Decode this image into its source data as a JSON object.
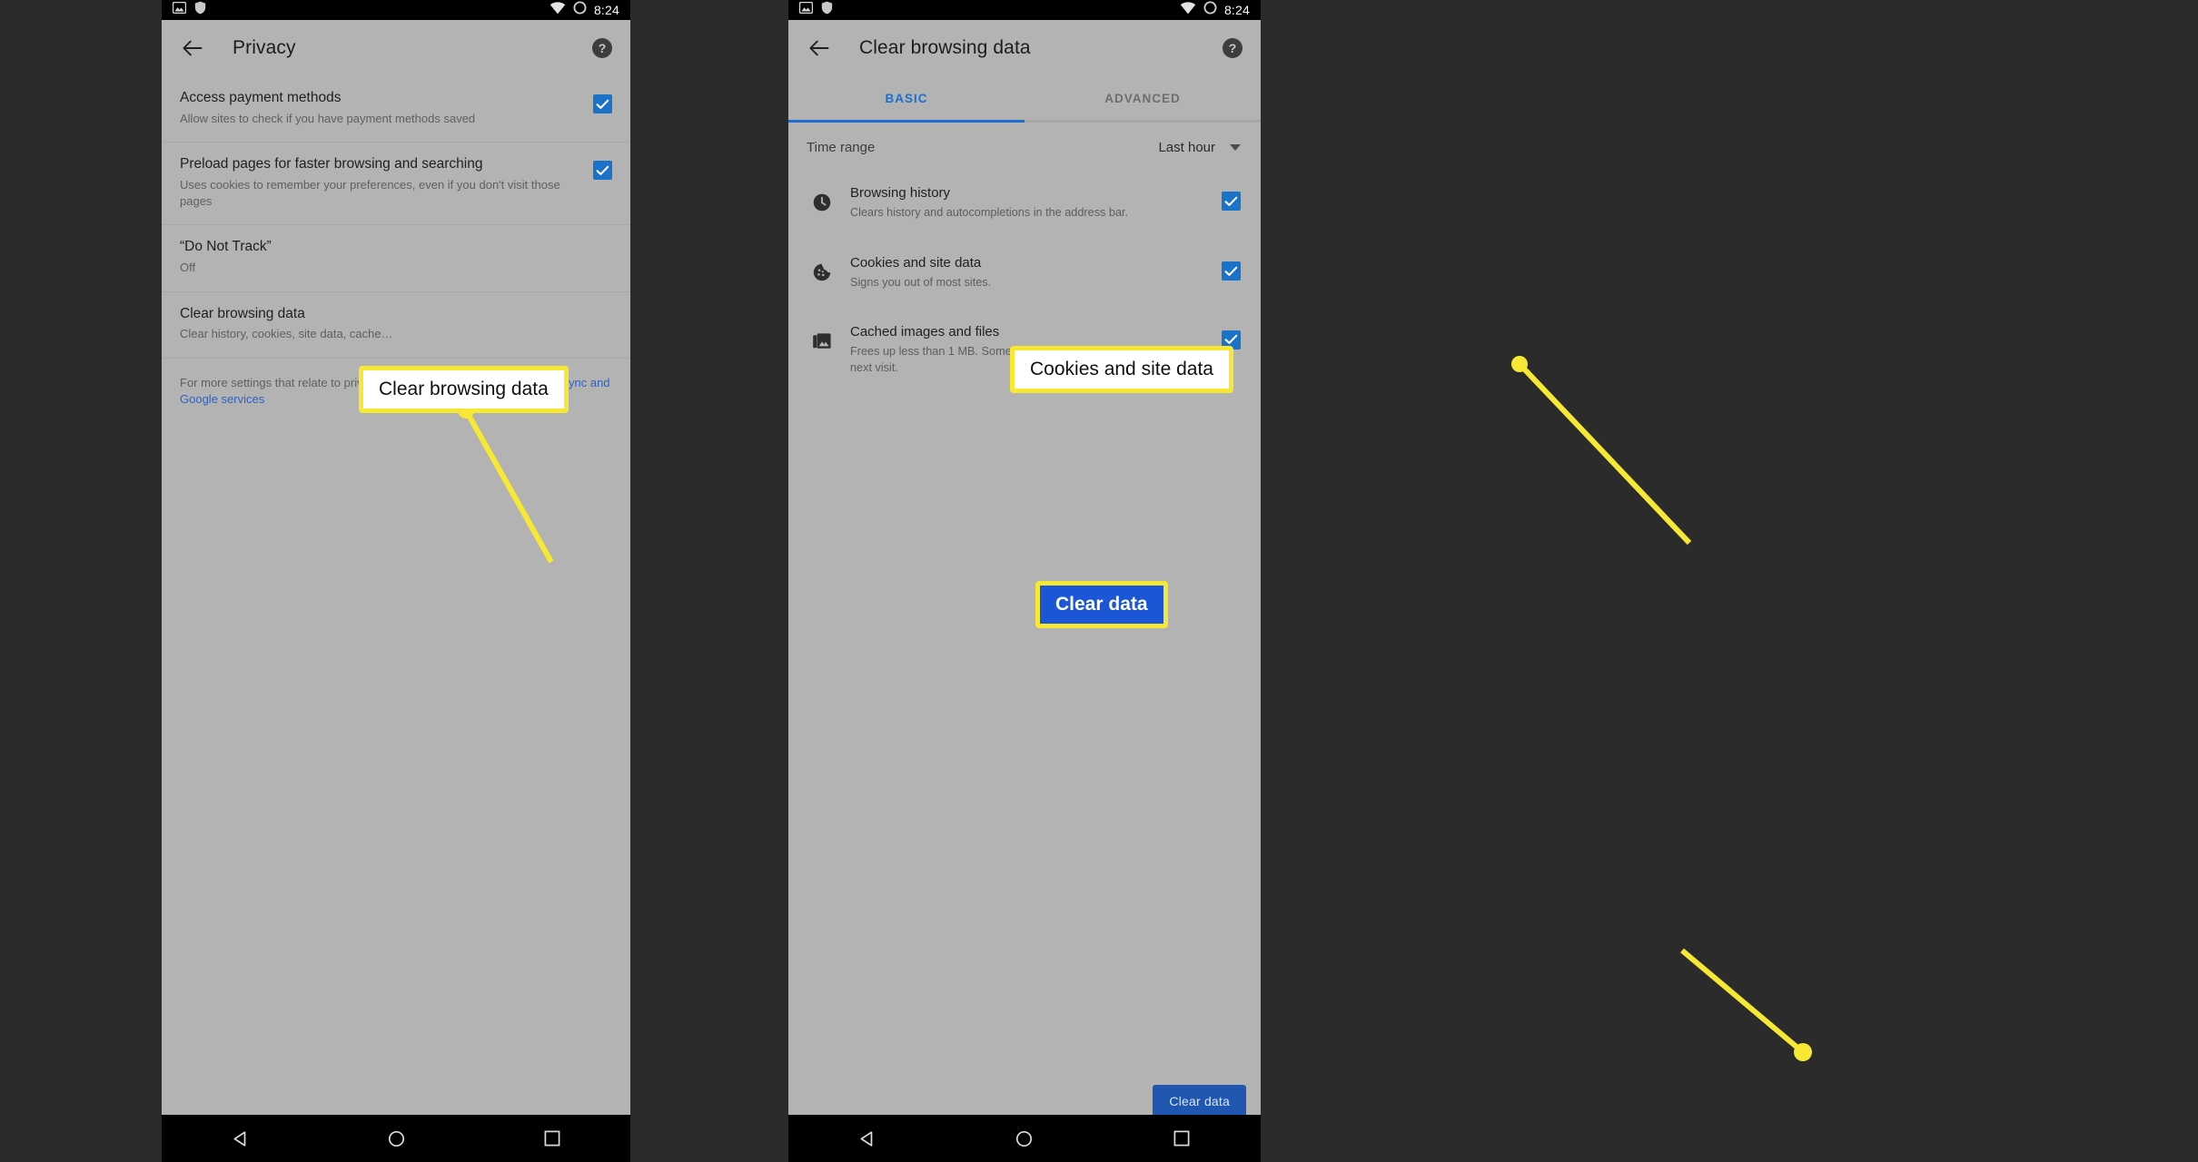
{
  "statusbar": {
    "time": "8:24",
    "icons_left": [
      "image-icon",
      "shield-icon"
    ],
    "icons_right": [
      "wifi-icon",
      "battery-circle-icon"
    ]
  },
  "left_phone": {
    "appbar": {
      "back_label": "back-arrow",
      "title": "Privacy",
      "help_label": "help"
    },
    "rows": [
      {
        "title": "Access payment methods",
        "subtitle": "Allow sites to check if you have payment methods saved",
        "checked": true
      },
      {
        "title": "Preload pages for faster browsing and searching",
        "subtitle": "Uses cookies to remember your preferences, even if you don't visit those pages",
        "checked": true
      },
      {
        "title": "“Do Not Track”",
        "subtitle": "Off",
        "checked": false
      },
      {
        "title": "Clear browsing data",
        "subtitle": "Clear history, cookies, site data, cache…",
        "checked": false
      }
    ],
    "footer": {
      "text_before": "For more settings that relate to privacy, security, and data collection, see ",
      "link_text": "Sync and Google services"
    }
  },
  "right_phone": {
    "appbar": {
      "back_label": "back-arrow",
      "title": "Clear browsing data",
      "help_label": "help"
    },
    "tabs": [
      {
        "label": "BASIC",
        "active": true
      },
      {
        "label": "ADVANCED",
        "active": false
      }
    ],
    "time_range": {
      "label": "Time range",
      "value": "Last hour"
    },
    "data_rows": [
      {
        "icon": "clock-icon",
        "title": "Browsing history",
        "subtitle": "Clears history and autocompletions in the address bar.",
        "checked": true
      },
      {
        "icon": "cookie-icon",
        "title": "Cookies and site data",
        "subtitle": "Signs you out of most sites.",
        "checked": true
      },
      {
        "icon": "image-stack-icon",
        "title": "Cached images and files",
        "subtitle": "Frees up less than 1 MB. Some sites may load more slowly on your next visit.",
        "checked": true
      }
    ],
    "clear_button": "Clear data"
  },
  "navbar": {
    "back": "nav-back-triangle",
    "home": "nav-home-circle",
    "recents": "nav-recents-square"
  },
  "annotations": [
    {
      "id": "left",
      "text": "Clear browsing data",
      "style": "white"
    },
    {
      "id": "cookies",
      "text": "Cookies and site data",
      "style": "white"
    },
    {
      "id": "cleardata",
      "text": "Clear data",
      "style": "blue"
    }
  ],
  "colors": {
    "accent_blue": "#1a73c8",
    "tab_blue": "#1a6fd0",
    "link_blue": "#2c62c4",
    "annotation_yellow": "#f7e833",
    "button_blue": "#1f56b0",
    "screen_bg": "#b3b3b3",
    "page_bg": "#2b2b2b"
  }
}
